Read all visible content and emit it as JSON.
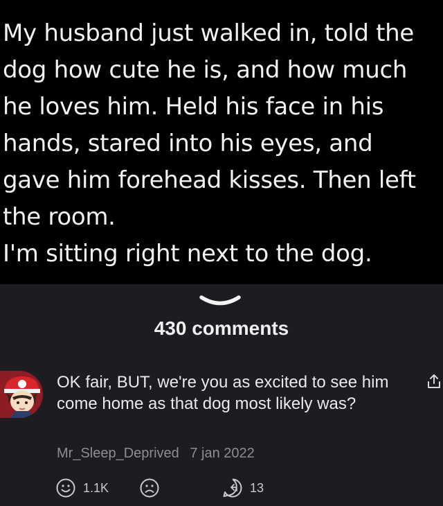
{
  "post": {
    "lines": [
      "My husband just walked in, told the",
      "dog how cute he is, and how much",
      "he loves him. Held his face in his",
      "hands, stared into his eyes, and",
      "gave him forehead kisses. Then left",
      "the room.",
      "I'm sitting right next to the dog."
    ]
  },
  "comments": {
    "count_label": "430 comments"
  },
  "comment": {
    "text": "OK fair, BUT, we're you as excited to see him come home as that dog most likely was?",
    "author": "Mr_Sleep_Deprived",
    "date": "7 jan 2022",
    "upvotes": "1.1K",
    "replies": "13"
  },
  "colors": {
    "background": "#000000",
    "panel": "#1c1c21",
    "meta_text": "#8d8d94",
    "avatar_red": "#8e1c24"
  },
  "icons": {
    "collapse": "chevron-down-icon",
    "share": "share-icon",
    "upvote": "smile-icon",
    "downvote": "frown-icon",
    "reply": "reply-icon"
  }
}
